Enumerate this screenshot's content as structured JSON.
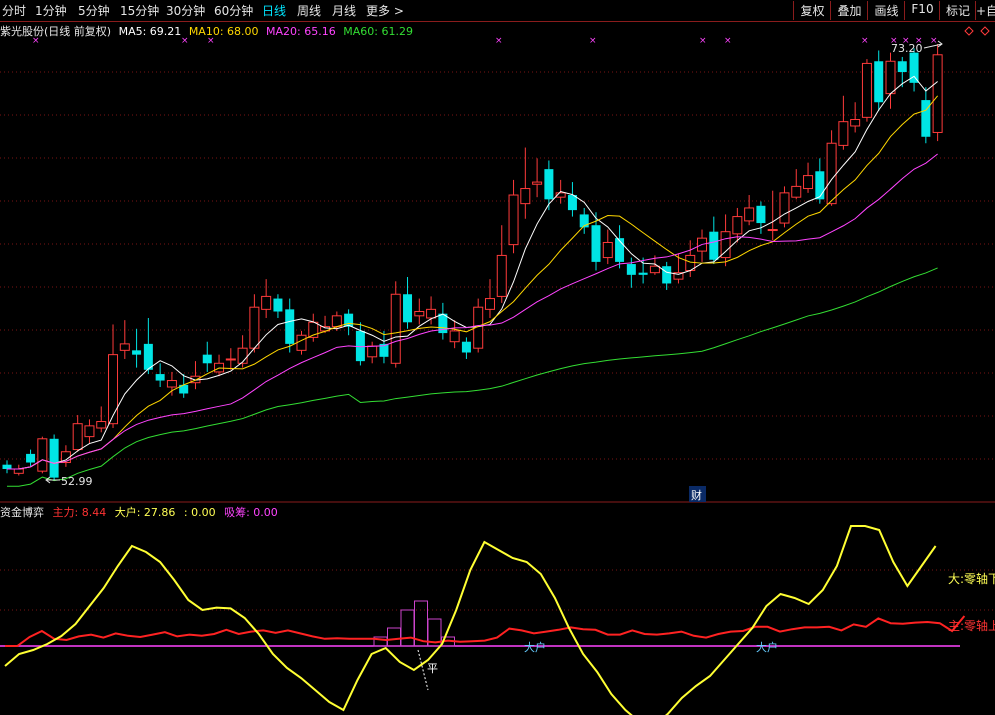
{
  "toolbar": {
    "periods": [
      {
        "label": "分时",
        "active": false
      },
      {
        "label": "1分钟",
        "active": false
      },
      {
        "label": "5分钟",
        "active": false
      },
      {
        "label": "15分钟",
        "active": false
      },
      {
        "label": "30分钟",
        "active": false
      },
      {
        "label": "60分钟",
        "active": false
      },
      {
        "label": "日线",
        "active": true
      },
      {
        "label": "周线",
        "active": false
      },
      {
        "label": "月线",
        "active": false
      },
      {
        "label": "更多 >",
        "active": false
      }
    ],
    "buttons": [
      "复权",
      "叠加",
      "画线",
      "F10",
      "标记",
      "+自"
    ]
  },
  "main_panel": {
    "title": "紫光股份(日线 前复权)",
    "ma": [
      {
        "label": "MA5: 69.21",
        "color": "#ffffff"
      },
      {
        "label": "MA10: 68.00",
        "color": "#ffd700"
      },
      {
        "label": "MA20: 65.16",
        "color": "#ff44ff"
      },
      {
        "label": "MA60: 61.29",
        "color": "#33dd33"
      }
    ],
    "high_label": "73.20",
    "low_label": "52.99",
    "finance_marker": "财"
  },
  "indicator_panel": {
    "title": "资金博弈",
    "items": [
      {
        "label": "主力: 8.44",
        "color": "#ff3333"
      },
      {
        "label": "大户: 27.86",
        "color": "#ffff55"
      },
      {
        "label": ": 0.00",
        "color": "#ffff55"
      },
      {
        "label": "吸筹: 0.00",
        "color": "#ff44ff"
      }
    ],
    "notes": {
      "big_zero": "大:零轴下",
      "main_zero": "主:零轴上",
      "dahu_1": "大户",
      "dahu_2": "大户",
      "ping": "平"
    }
  },
  "chart_data": {
    "type": "candlestick",
    "price_marks": {
      "high": 73.2,
      "low": 52.99
    },
    "ma_values": {
      "MA5": 69.21,
      "MA10": 68.0,
      "MA20": 65.16,
      "MA60": 61.29
    },
    "candles": [
      [
        53.7,
        53.5,
        53.9,
        53.3
      ],
      [
        53.3,
        53.5,
        53.7,
        53.2
      ],
      [
        54.2,
        53.8,
        54.4,
        53.6
      ],
      [
        53.4,
        54.9,
        55.0,
        53.3
      ],
      [
        54.9,
        53.1,
        55.1,
        52.99
      ],
      [
        53.8,
        54.3,
        54.6,
        53.6
      ],
      [
        54.4,
        55.6,
        56.0,
        54.3
      ],
      [
        55.0,
        55.5,
        55.8,
        54.7
      ],
      [
        55.4,
        55.7,
        56.4,
        55.2
      ],
      [
        55.6,
        58.8,
        60.2,
        55.4
      ],
      [
        59.0,
        59.3,
        60.4,
        58.6
      ],
      [
        59.0,
        58.8,
        60.0,
        58.2
      ],
      [
        59.3,
        58.1,
        60.5,
        57.9
      ],
      [
        57.9,
        57.6,
        58.4,
        57.3
      ],
      [
        57.3,
        57.6,
        58.0,
        56.9
      ],
      [
        57.4,
        57.0,
        57.9,
        56.8
      ],
      [
        57.5,
        57.8,
        58.5,
        57.2
      ],
      [
        58.8,
        58.4,
        59.4,
        58.0
      ],
      [
        58.0,
        58.4,
        58.8,
        57.8
      ],
      [
        58.6,
        58.6,
        59.1,
        58.1
      ],
      [
        58.4,
        59.1,
        59.7,
        58.2
      ],
      [
        59.1,
        61.0,
        61.6,
        58.9
      ],
      [
        60.9,
        61.5,
        62.3,
        60.5
      ],
      [
        61.4,
        60.8,
        61.6,
        60.5
      ],
      [
        60.9,
        59.3,
        61.4,
        58.9
      ],
      [
        59.0,
        59.7,
        59.9,
        58.8
      ],
      [
        59.6,
        60.3,
        60.7,
        59.4
      ],
      [
        59.9,
        60.1,
        60.6,
        59.8
      ],
      [
        60.1,
        60.6,
        60.8,
        59.9
      ],
      [
        60.7,
        60.1,
        60.9,
        59.7
      ],
      [
        59.9,
        58.5,
        60.3,
        58.3
      ],
      [
        58.7,
        59.2,
        59.4,
        58.4
      ],
      [
        59.3,
        58.7,
        59.9,
        58.4
      ],
      [
        58.4,
        61.6,
        62.2,
        58.2
      ],
      [
        61.6,
        60.3,
        62.4,
        60.0
      ],
      [
        60.6,
        60.8,
        61.4,
        60.2
      ],
      [
        60.5,
        60.9,
        61.5,
        60.2
      ],
      [
        60.7,
        59.8,
        61.2,
        59.5
      ],
      [
        59.4,
        59.9,
        60.4,
        59.1
      ],
      [
        59.4,
        58.9,
        59.6,
        58.6
      ],
      [
        59.1,
        61.0,
        61.4,
        58.9
      ],
      [
        60.9,
        61.4,
        62.3,
        60.5
      ],
      [
        61.5,
        63.4,
        64.8,
        61.2
      ],
      [
        63.9,
        66.2,
        66.9,
        63.5
      ],
      [
        65.8,
        66.5,
        68.4,
        65.1
      ],
      [
        66.7,
        66.8,
        67.9,
        66.1
      ],
      [
        67.4,
        66.0,
        67.8,
        65.5
      ],
      [
        66.1,
        66.3,
        66.9,
        65.8
      ],
      [
        66.2,
        65.5,
        66.8,
        65.2
      ],
      [
        65.3,
        64.7,
        65.6,
        64.4
      ],
      [
        64.8,
        63.1,
        65.4,
        62.7
      ],
      [
        63.3,
        64.0,
        64.6,
        63.0
      ],
      [
        64.2,
        63.1,
        64.8,
        62.8
      ],
      [
        63.0,
        62.5,
        63.3,
        61.9
      ],
      [
        62.6,
        62.5,
        63.3,
        62.1
      ],
      [
        62.6,
        62.9,
        63.4,
        62.5
      ],
      [
        62.9,
        62.1,
        63.1,
        61.8
      ],
      [
        62.3,
        62.6,
        63.5,
        62.1
      ],
      [
        62.7,
        63.4,
        64.1,
        62.4
      ],
      [
        63.6,
        64.2,
        64.6,
        63.1
      ],
      [
        64.5,
        63.2,
        65.2,
        63.0
      ],
      [
        63.3,
        64.5,
        65.3,
        62.9
      ],
      [
        64.4,
        65.2,
        65.6,
        64.0
      ],
      [
        65.0,
        65.6,
        66.2,
        64.8
      ],
      [
        65.7,
        64.9,
        65.9,
        64.4
      ],
      [
        64.6,
        64.6,
        66.4,
        64.1
      ],
      [
        64.9,
        66.3,
        66.6,
        64.7
      ],
      [
        66.1,
        66.6,
        67.4,
        66.0
      ],
      [
        66.5,
        67.1,
        67.7,
        66.3
      ],
      [
        67.3,
        66.0,
        67.9,
        65.8
      ],
      [
        65.8,
        68.6,
        69.2,
        65.7
      ],
      [
        68.5,
        69.6,
        70.8,
        68.3
      ],
      [
        69.4,
        69.7,
        70.5,
        69.1
      ],
      [
        69.8,
        72.3,
        72.5,
        69.6
      ],
      [
        72.4,
        70.5,
        72.9,
        70.1
      ],
      [
        70.9,
        72.4,
        72.8,
        70.2
      ],
      [
        72.4,
        71.9,
        72.6,
        71.2
      ],
      [
        72.8,
        71.4,
        73.0,
        71.0
      ],
      [
        70.6,
        68.9,
        71.2,
        68.6
      ],
      [
        69.1,
        72.7,
        73.2,
        68.7
      ]
    ],
    "series": [
      {
        "name": "MA5",
        "values": []
      },
      {
        "name": "MA10",
        "values": []
      },
      {
        "name": "MA20",
        "values": []
      },
      {
        "name": "MA60",
        "values": []
      }
    ],
    "indicator": {
      "zhuli": [
        0,
        0,
        1.5,
        2.5,
        1.2,
        1.0,
        1.6,
        1.9,
        1.4,
        2.1,
        1.7,
        1.5,
        1.9,
        2.3,
        1.6,
        1.9,
        1.7,
        2.0,
        2.7,
        2.0,
        2.4,
        2.6,
        2.2,
        2.6,
        2.1,
        1.6,
        1.2,
        1.3,
        1.2,
        1.2,
        1.2,
        1.0,
        1.2,
        1.4,
        0.8,
        0.6,
        0.9,
        0.7,
        0.8,
        0.9,
        1.4,
        2.9,
        2.6,
        2.1,
        2.4,
        2.7,
        3.1,
        2.8,
        2.7,
        1.9,
        1.9,
        2.6,
        2.0,
        1.9,
        2.1,
        2.4,
        1.7,
        1.4,
        2.0,
        2.4,
        2.5,
        3.2,
        3.2,
        2.4,
        2.8,
        3.1,
        3.1,
        3.2,
        2.6,
        3.6,
        3.2,
        4.6,
        3.8,
        3.7,
        3.9,
        4.0,
        3.8,
        2.5,
        5.0
      ],
      "dahu": [
        -5.0,
        -2.0,
        -1.0,
        0.5,
        2.5,
        5.5,
        10.0,
        14.5,
        20.0,
        25.0,
        23.5,
        21.0,
        16.5,
        11.5,
        9.0,
        9.6,
        9.4,
        7.0,
        3.0,
        -2.0,
        -5.5,
        -8.0,
        -11.0,
        -14.0,
        -16.0,
        -8.5,
        -2.0,
        -0.5,
        -4.0,
        -6.0,
        -3.5,
        0.5,
        9.0,
        19.0,
        26.0,
        24.0,
        22.0,
        21.0,
        18.0,
        12.0,
        4.5,
        -2.0,
        -6.5,
        -12.0,
        -16.0,
        -19.0,
        -20.0,
        -17.0,
        -13.0,
        -10.0,
        -7.5,
        -3.5,
        0.5,
        4.5,
        10.0,
        13.0,
        12.0,
        10.5,
        14.0,
        20.0,
        30.0,
        30.0,
        29.0,
        21.0,
        15.0,
        20.0,
        25.0
      ],
      "xichou_bars": [
        [
          4,
          1
        ],
        [
          5,
          2
        ],
        [
          6,
          4
        ],
        [
          7,
          5
        ],
        [
          8,
          3
        ],
        [
          9,
          1
        ]
      ]
    }
  }
}
